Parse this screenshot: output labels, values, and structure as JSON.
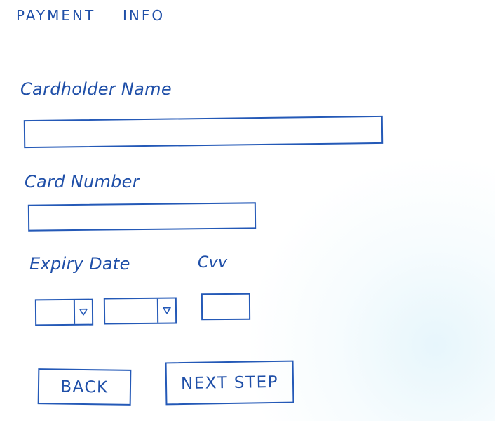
{
  "header": {
    "title_part_1": "PAYMENT",
    "title_part_2": "INFO"
  },
  "form": {
    "cardholder_name": {
      "label": "Cardholder Name",
      "value": "",
      "placeholder": ""
    },
    "card_number": {
      "label": "Card Number",
      "value": "",
      "placeholder": ""
    },
    "expiry_date": {
      "label": "Expiry Date",
      "month_value": "",
      "year_value": ""
    },
    "cvv": {
      "label": "Cvv",
      "value": "",
      "placeholder": ""
    }
  },
  "actions": {
    "back_label": "BACK",
    "next_label": "NEXT STEP"
  },
  "icons": {
    "dropdown": "chevron-down-icon"
  },
  "colors": {
    "ink": "#1f4fa8",
    "line": "#2459b7",
    "background": "#ffffff"
  }
}
